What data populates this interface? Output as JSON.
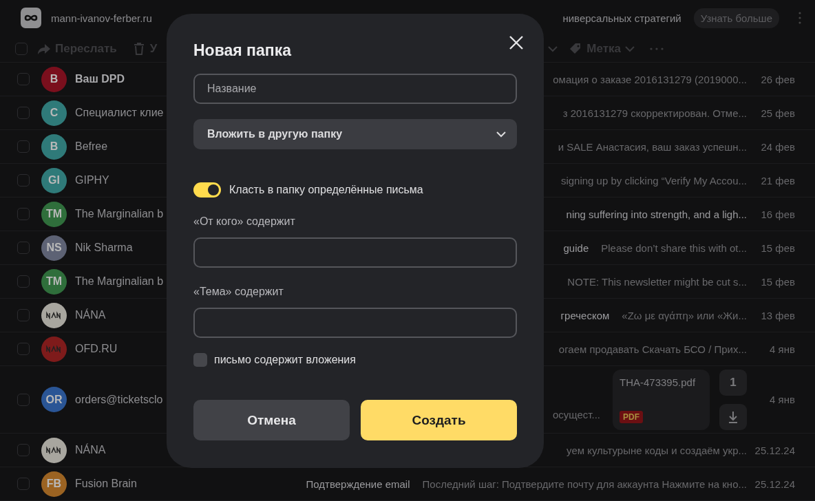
{
  "header": {
    "site": "mann-ivanov-ferber.ru",
    "ad_text": "ниверсальных стратегий",
    "ad_button": "Узнать больше"
  },
  "toolbar": {
    "select_all": {
      "checked": false
    },
    "forward": "Переслать",
    "delete": "У",
    "label": "Метка"
  },
  "messages": [
    {
      "sender": "Ваш DPD",
      "unread": true,
      "avatar": {
        "kind": "initials",
        "text": "В",
        "color": "#7a0f1d"
      },
      "snippet": "омация о заказе 2016131279 (2019000...",
      "date": "26 фев",
      "checked": false
    },
    {
      "sender": "Специалист клие",
      "unread": false,
      "avatar": {
        "kind": "initials",
        "text": "С",
        "color": "#2f7a79"
      },
      "snippet": "з 2016131279 скорректирован. Отме...",
      "date": "25 фев",
      "checked": false
    },
    {
      "sender": "Befree",
      "unread": false,
      "avatar": {
        "kind": "initials",
        "text": "B",
        "color": "#2f7a79"
      },
      "snippet": "и SALE Анастасия, ваш заказ успешн...",
      "date": "24 фев",
      "checked": false
    },
    {
      "sender": "GIPHY",
      "unread": false,
      "avatar": {
        "kind": "initials",
        "text": "GI",
        "color": "#2f7a79"
      },
      "snippet": "signing up by clicking “Verify My Accou...",
      "date": "21 фев",
      "checked": false
    },
    {
      "sender": "The Marginalian b",
      "unread": false,
      "avatar": {
        "kind": "initials",
        "text": "TM",
        "color": "#2f6e3b"
      },
      "subject": "ning suffering into strength, and a ligh...",
      "date": "16 фев",
      "checked": false
    },
    {
      "sender": "Nik Sharma",
      "unread": false,
      "avatar": {
        "kind": "initials",
        "text": "NS",
        "color": "#5d6274"
      },
      "subject": "guide",
      "snippet": "Please don’t share this with ot...",
      "date": "15 фев",
      "checked": false
    },
    {
      "sender": "The Marginalian b",
      "unread": false,
      "avatar": {
        "kind": "initials",
        "text": "TM",
        "color": "#2f6e3b"
      },
      "snippet": "NOTE: This newsletter might be cut s...",
      "date": "15 фев",
      "checked": false
    },
    {
      "sender": "NÁNA",
      "unread": false,
      "avatar": {
        "kind": "logo",
        "color": "#a8a69f"
      },
      "subject": "греческом",
      "snippet": "«Ζω με αγάπη» или «Жи...",
      "date": "13 фев",
      "checked": false
    },
    {
      "sender": "OFD.RU",
      "unread": false,
      "avatar": {
        "kind": "logo",
        "color": "#7e1b1b"
      },
      "snippet": "огаем продавать Скачать БСО / Прих...",
      "date": "4 янв",
      "checked": false
    },
    {
      "sender": "orders@ticketsclo",
      "unread": false,
      "avatar": {
        "kind": "initials",
        "text": "OR",
        "color": "#2a5595"
      },
      "snippet": "осущест...",
      "attachment": {
        "name": "THA-473395.pdf",
        "type": "PDF",
        "count": "1"
      },
      "date": "4 янв",
      "checked": false
    },
    {
      "sender": "NÁNA",
      "unread": false,
      "avatar": {
        "kind": "logo",
        "color": "#a8a69f"
      },
      "snippet": "уем культурыне коды и создаём укр...",
      "date": "25.12.24",
      "checked": false
    },
    {
      "sender": "Fusion Brain",
      "unread": false,
      "avatar": {
        "kind": "initials",
        "text": "FB",
        "color": "#9b6322"
      },
      "subject": "Подтверждение email",
      "snippet": "Последний шаг: Подтвердите почту для аккаунта Нажмите на кно...",
      "date": "25.12.24",
      "checked": false
    }
  ],
  "dialog": {
    "title": "Новая папка",
    "name_field": {
      "placeholder": "Название"
    },
    "parent_select": "Вложить в другую папку",
    "filter_toggle": {
      "label": "Класть в папку определённые письма",
      "on": true
    },
    "from_field": {
      "label": "«От кого» содержит"
    },
    "subject_field": {
      "label": "«Тема» содержит"
    },
    "attachments_checkbox": {
      "label": "письмо содержит вложения",
      "checked": false
    },
    "buttons": [
      {
        "kind": "secondary",
        "label": "Отмена"
      },
      {
        "kind": "primary",
        "label": "Создать"
      }
    ]
  }
}
